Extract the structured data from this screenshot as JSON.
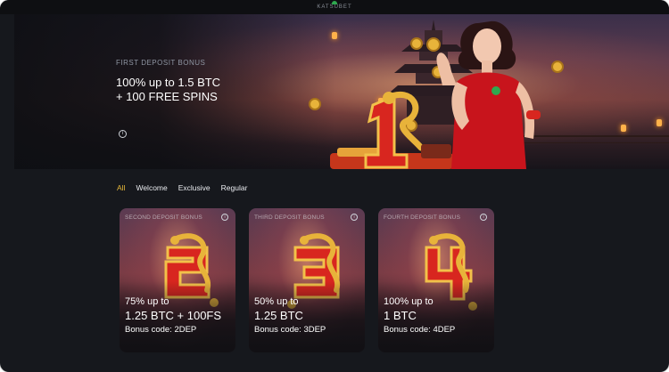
{
  "header": {
    "logo_text": "KATSUBET"
  },
  "hero": {
    "kicker": "FIRST DEPOSIT BONUS",
    "title_line1": "100% up to 1.5 BTC",
    "title_line2": "+ 100 FREE SPINS",
    "info_icon": "info-icon"
  },
  "tabs": [
    "All",
    "Welcome",
    "Exclusive",
    "Regular"
  ],
  "active_tab": "All",
  "cards": [
    {
      "label": "SECOND DEPOSIT BONUS",
      "numeral": "2",
      "line1": "75% up to",
      "line2": "1.25 BTC + 100FS",
      "code": "Bonus code: 2DEP"
    },
    {
      "label": "THIRD DEPOSIT BONUS",
      "numeral": "3",
      "line1": "50% up to",
      "line2": "1.25 BTC",
      "code": "Bonus code: 3DEP"
    },
    {
      "label": "FOURTH DEPOSIT BONUS",
      "numeral": "4",
      "line1": "100% up to",
      "line2": "1 BTC",
      "code": "Bonus code: 4DEP"
    }
  ],
  "colors": {
    "accent": "#e6b73a",
    "background": "#16181d",
    "numeral_red": "#d8261f",
    "gold": "#e8b33a"
  }
}
